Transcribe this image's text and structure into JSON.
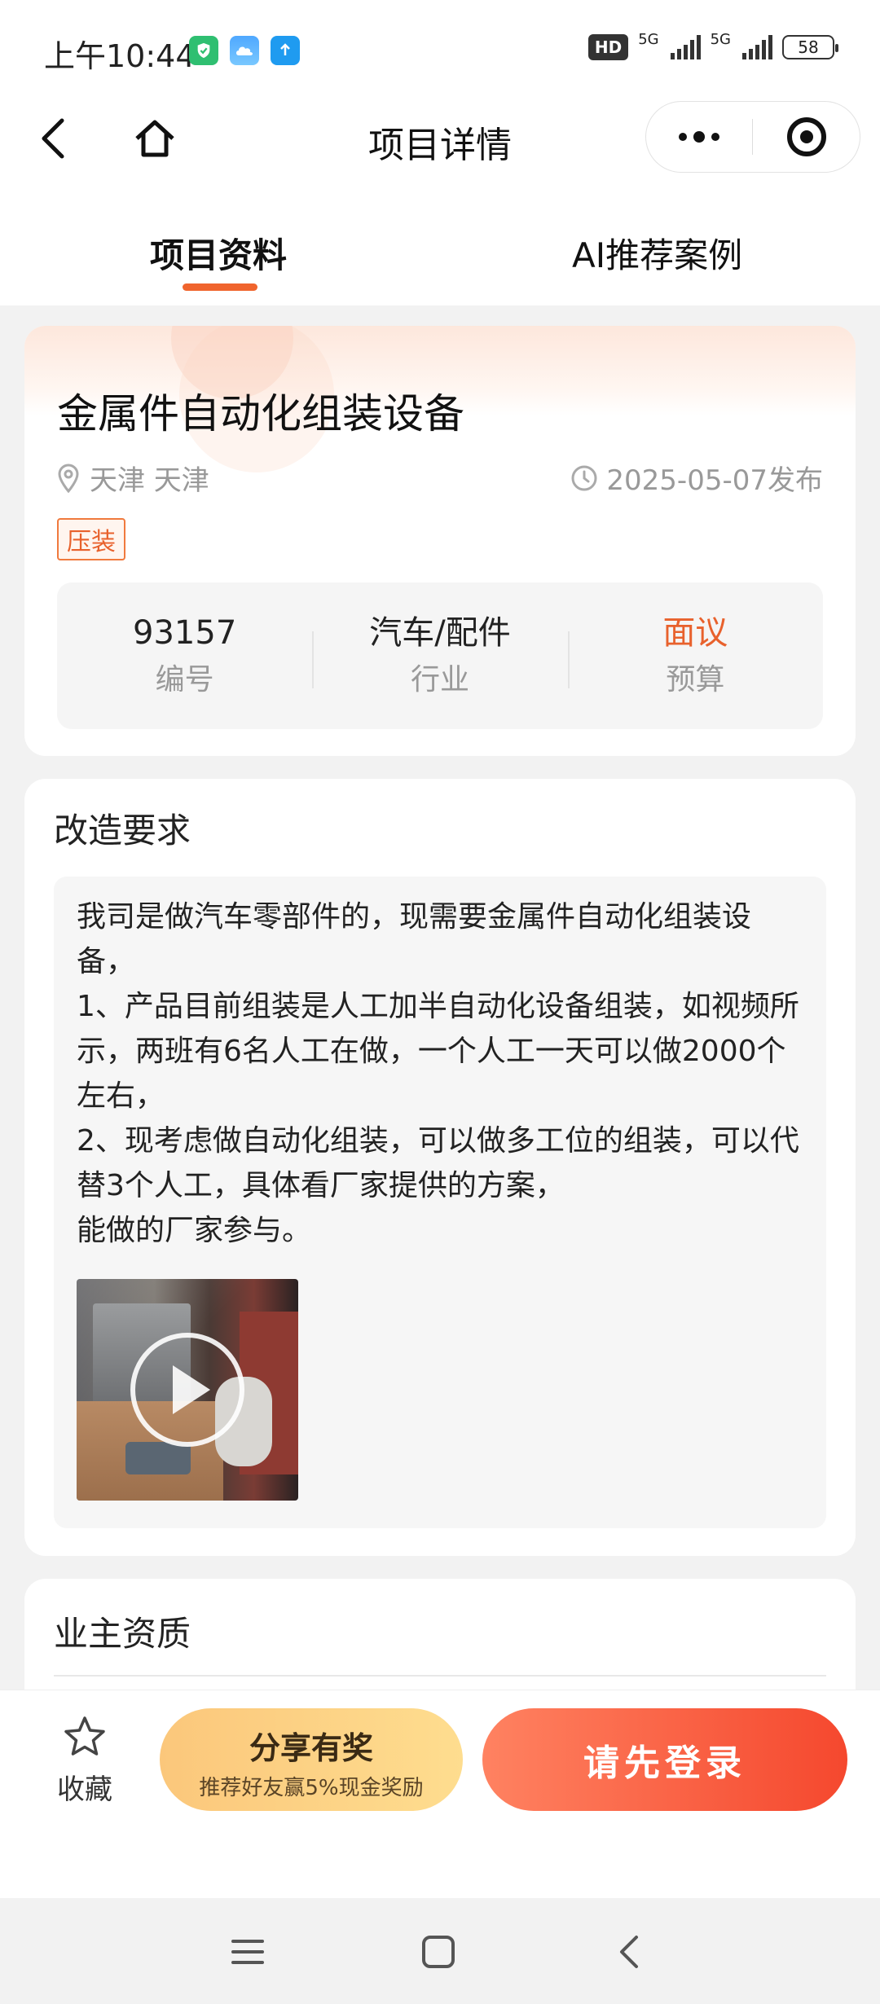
{
  "status_bar": {
    "time": "上午10:44",
    "hd_label": "HD",
    "network_1": "5G",
    "network_2": "5G",
    "battery": "58"
  },
  "header": {
    "title": "项目详情"
  },
  "tabs": [
    {
      "label": "项目资料",
      "active": true
    },
    {
      "label": "AI推荐案例",
      "active": false
    }
  ],
  "project": {
    "title": "金属件自动化组装设备",
    "location": "天津 天津",
    "publish_date": "2025-05-07发布",
    "tag": "压装",
    "stats": [
      {
        "value": "93157",
        "label": "编号"
      },
      {
        "value": "汽车/配件",
        "label": "行业"
      },
      {
        "value": "面议",
        "label": "预算"
      }
    ]
  },
  "requirements": {
    "title": "改造要求",
    "text": "我司是做汽车零部件的，现需要金属件自动化组装设备，\n1、产品目前组装是人工加半自动化设备组装，如视频所示，两班有6名人工在做，一个人工一天可以做2000个左右，\n2、现考虑做自动化组装，可以做多工位的组装，可以代替3个人工，具体看厂家提供的方案，\n能做的厂家参与。"
  },
  "owner": {
    "title": "业主资质"
  },
  "bottom_bar": {
    "favorite_label": "收藏",
    "share_title": "分享有奖",
    "share_subtitle": "推荐好友赢5%现金奖励",
    "login_label": "请先登录"
  },
  "colors": {
    "accent": "#e8612c",
    "login_gradient_start": "#ff8261",
    "login_gradient_end": "#f5482e",
    "share_gradient_start": "#fbc77b",
    "share_gradient_end": "#fedd8f"
  }
}
